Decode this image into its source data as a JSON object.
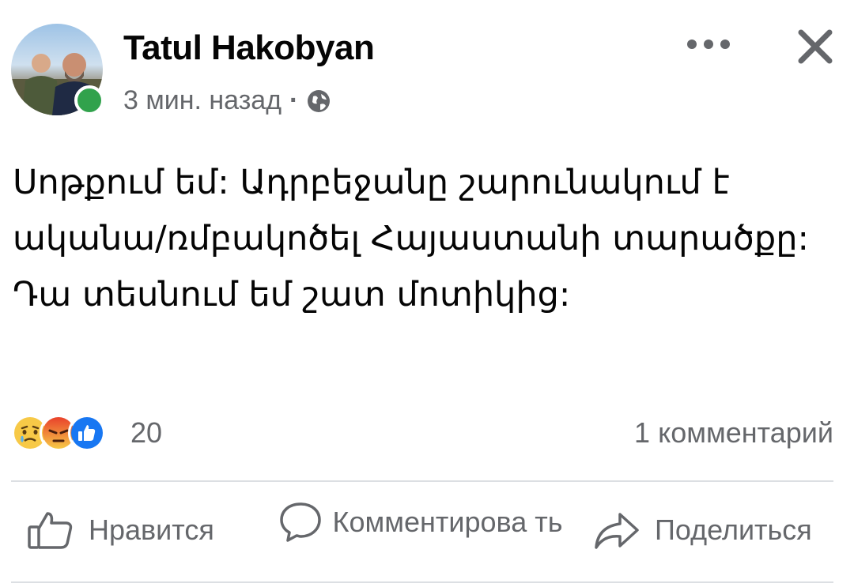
{
  "post": {
    "author_name": "Tatul Hakobyan",
    "timestamp": "3 мин. назад",
    "separator": "·",
    "privacy_icon": "globe-icon",
    "body_text": "Սոթքում եմ: Ադրբեջանը շարունակում է ականա/ռմբակոծել Հայաստանի տարածքը: Դա տեսնում եմ շատ մոտիկից:",
    "online_status_color": "#31a24c"
  },
  "header_actions": {
    "more_icon": "more-horizontal-icon",
    "close_icon": "close-icon"
  },
  "reactions": {
    "icons": [
      "sad-reaction-icon",
      "angry-reaction-icon",
      "like-reaction-icon"
    ],
    "count": "20",
    "comments": "1 комментарий"
  },
  "actions": {
    "like_label": "Нравится",
    "comment_label": "Комментирова ть",
    "share_label": "Поделиться"
  },
  "colors": {
    "secondary_text": "#65676b",
    "like_blue": "#1877f2",
    "divider": "#dcdfe3"
  }
}
